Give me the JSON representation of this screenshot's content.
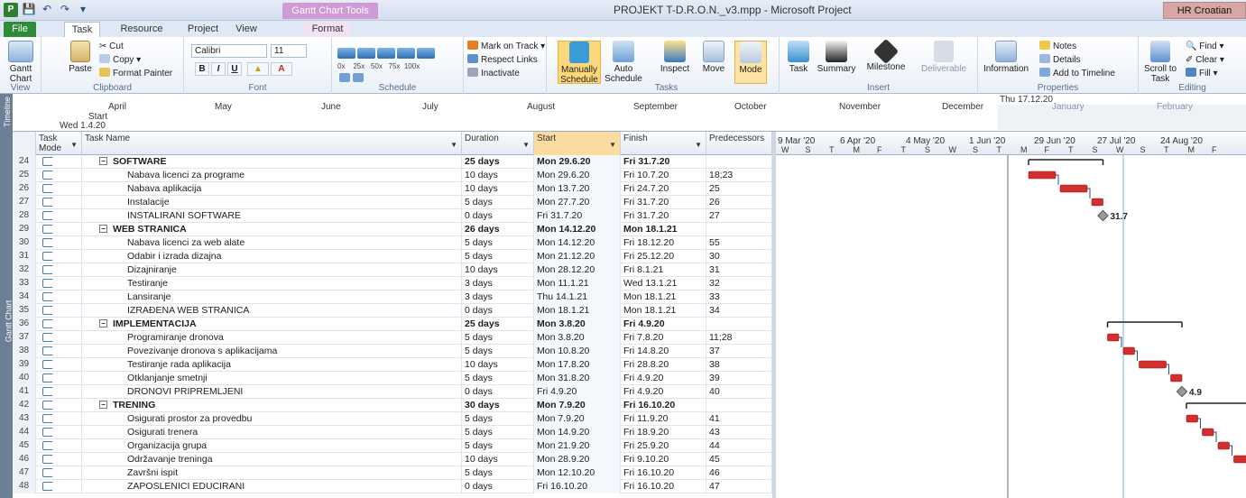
{
  "window": {
    "app_icon": "P",
    "title": "PROJEKT T-D.R.O.N._v3.mpp - Microsoft Project",
    "context_tab": "Gantt Chart Tools",
    "user": "HR Croatian"
  },
  "tabs": [
    {
      "label": "File"
    },
    {
      "label": "Task"
    },
    {
      "label": "Resource"
    },
    {
      "label": "Project"
    },
    {
      "label": "View"
    },
    {
      "label": "Format"
    }
  ],
  "ribbon": {
    "view": {
      "gantt_label": "Gantt Chart",
      "group": "View"
    },
    "clipboard": {
      "paste": "Paste",
      "cut": "Cut",
      "copy": "Copy",
      "format_painter": "Format Painter",
      "group": "Clipboard"
    },
    "font": {
      "family": "Calibri",
      "size": "11",
      "bold": "B",
      "italic": "I",
      "underline": "U",
      "group": "Font"
    },
    "schedule": {
      "pct": [
        "0x",
        "25x",
        "50x",
        "75x",
        "100x"
      ],
      "mark_on_track": "Mark on Track",
      "respect_links": "Respect Links",
      "inactivate": "Inactivate",
      "group": "Schedule"
    },
    "tasks": {
      "manually": "Manually Schedule",
      "auto": "Auto Schedule",
      "inspect": "Inspect",
      "move": "Move",
      "mode": "Mode",
      "group": "Tasks"
    },
    "insert": {
      "task": "Task",
      "summary": "Summary",
      "milestone": "Milestone",
      "deliverable": "Deliverable",
      "group": "Insert"
    },
    "properties": {
      "information": "Information",
      "notes": "Notes",
      "details": "Details",
      "add_to_timeline": "Add to Timeline",
      "group": "Properties"
    },
    "editing": {
      "scroll_to_task": "Scroll to Task",
      "find": "Find",
      "clear": "Clear",
      "fill": "Fill",
      "group": "Editing"
    }
  },
  "timeline": {
    "side_label": "Timeline",
    "start_label": "Start",
    "start_date": "Wed 1.4.20",
    "finish_date": "Thu 17.12.20",
    "months": [
      "April",
      "May",
      "June",
      "July",
      "August",
      "September",
      "October",
      "November",
      "December",
      "January",
      "February"
    ]
  },
  "gantt_side_label": "Gantt Chart",
  "columns": {
    "mode": "Task Mode",
    "name": "Task Name",
    "duration": "Duration",
    "start": "Start",
    "finish": "Finish",
    "pred": "Predecessors"
  },
  "tasks": [
    {
      "id": "24",
      "name": "SOFTWARE",
      "duration": "25 days",
      "start": "Mon 29.6.20",
      "finish": "Fri 31.7.20",
      "pred": "",
      "summary": true
    },
    {
      "id": "25",
      "name": "Nabava licenci za programe",
      "duration": "10 days",
      "start": "Mon 29.6.20",
      "finish": "Fri 10.7.20",
      "pred": "18;23",
      "summary": false
    },
    {
      "id": "26",
      "name": "Nabava aplikacija",
      "duration": "10 days",
      "start": "Mon 13.7.20",
      "finish": "Fri 24.7.20",
      "pred": "25",
      "summary": false
    },
    {
      "id": "27",
      "name": "Instalacije",
      "duration": "5 days",
      "start": "Mon 27.7.20",
      "finish": "Fri 31.7.20",
      "pred": "26",
      "summary": false
    },
    {
      "id": "28",
      "name": "INSTALIRANI SOFTWARE",
      "duration": "0 days",
      "start": "Fri 31.7.20",
      "finish": "Fri 31.7.20",
      "pred": "27",
      "summary": false
    },
    {
      "id": "29",
      "name": "WEB STRANICA",
      "duration": "26 days",
      "start": "Mon 14.12.20",
      "finish": "Mon 18.1.21",
      "pred": "",
      "summary": true
    },
    {
      "id": "30",
      "name": "Nabava licenci za web alate",
      "duration": "5 days",
      "start": "Mon 14.12.20",
      "finish": "Fri 18.12.20",
      "pred": "55",
      "summary": false
    },
    {
      "id": "31",
      "name": "Odabir i izrada dizajna",
      "duration": "5 days",
      "start": "Mon 21.12.20",
      "finish": "Fri 25.12.20",
      "pred": "30",
      "summary": false
    },
    {
      "id": "32",
      "name": "Dizajniranje",
      "duration": "10 days",
      "start": "Mon 28.12.20",
      "finish": "Fri 8.1.21",
      "pred": "31",
      "summary": false
    },
    {
      "id": "33",
      "name": "Testiranje",
      "duration": "3 days",
      "start": "Mon 11.1.21",
      "finish": "Wed 13.1.21",
      "pred": "32",
      "summary": false
    },
    {
      "id": "34",
      "name": "Lansiranje",
      "duration": "3 days",
      "start": "Thu 14.1.21",
      "finish": "Mon 18.1.21",
      "pred": "33",
      "summary": false
    },
    {
      "id": "35",
      "name": "IZRAĐENA WEB STRANICA",
      "duration": "0 days",
      "start": "Mon 18.1.21",
      "finish": "Mon 18.1.21",
      "pred": "34",
      "summary": false
    },
    {
      "id": "36",
      "name": "IMPLEMENTACIJA",
      "duration": "25 days",
      "start": "Mon 3.8.20",
      "finish": "Fri 4.9.20",
      "pred": "",
      "summary": true
    },
    {
      "id": "37",
      "name": "Programiranje dronova",
      "duration": "5 days",
      "start": "Mon 3.8.20",
      "finish": "Fri 7.8.20",
      "pred": "11;28",
      "summary": false
    },
    {
      "id": "38",
      "name": "Povezivanje dronova s aplikacijama",
      "duration": "5 days",
      "start": "Mon 10.8.20",
      "finish": "Fri 14.8.20",
      "pred": "37",
      "summary": false
    },
    {
      "id": "39",
      "name": "Testiranje rada aplikacija",
      "duration": "10 days",
      "start": "Mon 17.8.20",
      "finish": "Fri 28.8.20",
      "pred": "38",
      "summary": false
    },
    {
      "id": "40",
      "name": "Otklanjanje smetnji",
      "duration": "5 days",
      "start": "Mon 31.8.20",
      "finish": "Fri 4.9.20",
      "pred": "39",
      "summary": false
    },
    {
      "id": "41",
      "name": "DRONOVI PRIPREMLJENI",
      "duration": "0 days",
      "start": "Fri 4.9.20",
      "finish": "Fri 4.9.20",
      "pred": "40",
      "summary": false
    },
    {
      "id": "42",
      "name": "TRENING",
      "duration": "30 days",
      "start": "Mon 7.9.20",
      "finish": "Fri 16.10.20",
      "pred": "",
      "summary": true
    },
    {
      "id": "43",
      "name": "Osigurati prostor za provedbu",
      "duration": "5 days",
      "start": "Mon 7.9.20",
      "finish": "Fri 11.9.20",
      "pred": "41",
      "summary": false
    },
    {
      "id": "44",
      "name": "Osigurati trenera",
      "duration": "5 days",
      "start": "Mon 14.9.20",
      "finish": "Fri 18.9.20",
      "pred": "43",
      "summary": false
    },
    {
      "id": "45",
      "name": "Organizacija grupa",
      "duration": "5 days",
      "start": "Mon 21.9.20",
      "finish": "Fri 25.9.20",
      "pred": "44",
      "summary": false
    },
    {
      "id": "46",
      "name": "Održavanje treninga",
      "duration": "10 days",
      "start": "Mon 28.9.20",
      "finish": "Fri 9.10.20",
      "pred": "45",
      "summary": false
    },
    {
      "id": "47",
      "name": "Završni ispit",
      "duration": "5 days",
      "start": "Mon 12.10.20",
      "finish": "Fri 16.10.20",
      "pred": "46",
      "summary": false
    },
    {
      "id": "48",
      "name": "ZAPOSLENICI EDUCIRANI",
      "duration": "0 days",
      "start": "Fri 16.10.20",
      "finish": "Fri 16.10.20",
      "pred": "47",
      "summary": false
    }
  ],
  "chart": {
    "weeks": [
      "9 Mar '20",
      "6 Apr '20",
      "4 May '20",
      "1 Jun '20",
      "29 Jun '20",
      "27 Jul '20",
      "24 Aug '20"
    ],
    "day_letters": [
      "W",
      "S",
      "T",
      "M",
      "F",
      "T",
      "S",
      "W",
      "S",
      "T",
      "M",
      "F",
      "T",
      "S",
      "W",
      "S",
      "T",
      "M",
      "F"
    ],
    "milestone_labels": [
      {
        "task_id": "28",
        "label": "31.7"
      },
      {
        "task_id": "41",
        "label": "4.9"
      }
    ],
    "bar_color": "#d32f2f",
    "summary_color": "#222222"
  }
}
